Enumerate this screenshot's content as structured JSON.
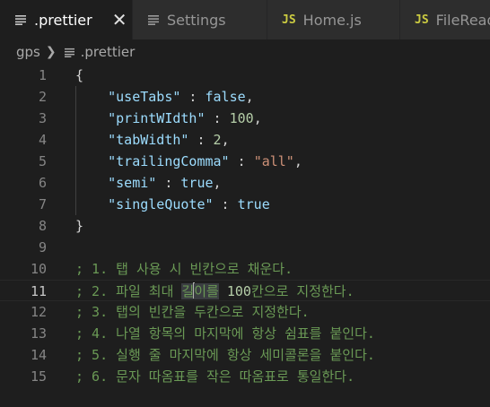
{
  "tabs": [
    {
      "label": ".prettier",
      "icon": "lines-file-icon",
      "active": true,
      "closable": true
    },
    {
      "label": "Settings",
      "icon": "lines-file-icon",
      "active": false
    },
    {
      "label": "Home.js",
      "icon": "js-file-icon",
      "icon_text": "JS",
      "active": false
    },
    {
      "label": "FileRead",
      "icon": "js-file-icon",
      "icon_text": "JS",
      "active": false
    }
  ],
  "breadcrumb": {
    "folder": "gps",
    "file": ".prettier"
  },
  "editor": {
    "active_line": 11,
    "line_numbers": [
      "1",
      "2",
      "3",
      "4",
      "5",
      "6",
      "7",
      "8",
      "9",
      "10",
      "11",
      "12",
      "13",
      "14",
      "15"
    ],
    "code": {
      "open_brace": "{",
      "close_brace": "}",
      "props": [
        {
          "key": "\"useTabs\"",
          "colon": " : ",
          "value": "false",
          "value_type": "keyword",
          "comma": ","
        },
        {
          "key": "\"printWIdth\"",
          "colon": " : ",
          "value": "100",
          "value_type": "number",
          "comma": ","
        },
        {
          "key": "\"tabWidth\"",
          "colon": " : ",
          "value": "2",
          "value_type": "number",
          "comma": ","
        },
        {
          "key": "\"trailingComma\"",
          "colon": " : ",
          "value": "\"all\"",
          "value_type": "string",
          "comma": ","
        },
        {
          "key": "\"semi\"",
          "colon": " : ",
          "value": "true",
          "value_type": "keyword",
          "comma": ","
        },
        {
          "key": "\"singleQuote\"",
          "colon": " : ",
          "value": "true",
          "value_type": "keyword",
          "comma": ""
        }
      ],
      "comments": [
        "; 1. 탭 사용 시 빈칸으로 채운다.",
        "; 2. 파일 최대 길이를 100칸으로 지정한다.",
        "; 3. 탭의 빈칸을 두칸으로 지정한다.",
        "; 4. 나열 항목의 마지막에 항상 쉼표를 붙인다.",
        "; 5. 실행 줄 마지막에 항상 세미콜론을 붙인다.",
        "; 6. 문자 따옴표를 작은 따옴표로 통일한다."
      ],
      "line11_parts": {
        "before": "; 2. 파일 최대 ",
        "sel1": "길",
        "sel2": "이를",
        "mid": " ",
        "num": "100",
        "after": "칸으로 지정한다."
      }
    }
  },
  "colors": {
    "background": "#1e1e1e",
    "tab_bar": "#252526",
    "json_key": "#9cdcfe",
    "json_string": "#ce9178",
    "json_number": "#b5cea8",
    "comment": "#6a9955",
    "js_icon": "#cbcb41"
  }
}
